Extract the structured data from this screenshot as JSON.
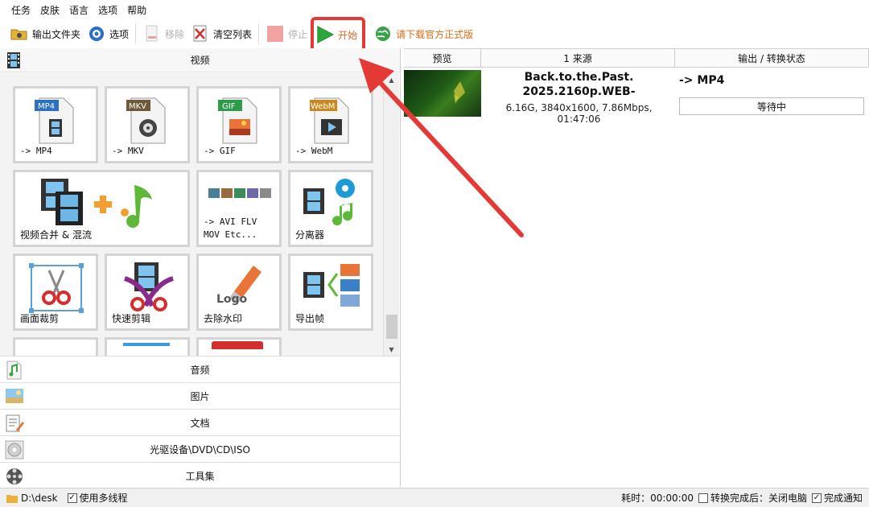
{
  "menu": [
    "任务",
    "皮肤",
    "语言",
    "选项",
    "帮助"
  ],
  "toolbar": {
    "output_folder": "输出文件夹",
    "options": "选项",
    "remove": "移除",
    "clear_list": "清空列表",
    "stop": "停止",
    "start": "开始",
    "download": "请下载官方正式版"
  },
  "left_panel": {
    "video_header": "视频",
    "tiles": [
      {
        "label": "-> MP4",
        "icon": "mp4-file-icon",
        "badge": "MP4",
        "badge_color": "#2f6fbf"
      },
      {
        "label": "-> MKV",
        "icon": "mkv-file-icon",
        "badge": "MKV",
        "badge_color": "#6d5a3a"
      },
      {
        "label": "-> GIF",
        "icon": "gif-file-icon",
        "badge": "GIF",
        "badge_color": "#2e9b4a"
      },
      {
        "label": "-> WebM",
        "icon": "webm-file-icon",
        "badge": "WebM",
        "badge_color": "#c8891e"
      },
      {
        "label": "视频合并 & 混流",
        "icon": "video-merge-icon"
      },
      {
        "label": "-> AVI FLV\nMOV Etc...",
        "icon": "other-formats-icon"
      },
      {
        "label": "分离器",
        "icon": "splitter-icon"
      },
      {
        "label": "画面裁剪",
        "icon": "crop-icon"
      },
      {
        "label": "快速剪辑",
        "icon": "quick-clip-icon"
      },
      {
        "label": "去除水印",
        "icon": "remove-watermark-icon",
        "logo_text": "Logo"
      },
      {
        "label": "导出帧",
        "icon": "export-frames-icon"
      }
    ],
    "categories": [
      {
        "label": "音频",
        "icon": "audio-icon"
      },
      {
        "label": "图片",
        "icon": "picture-icon"
      },
      {
        "label": "文档",
        "icon": "document-icon"
      },
      {
        "label": "光驱设备\\DVD\\CD\\ISO",
        "icon": "disc-icon"
      },
      {
        "label": "工具集",
        "icon": "toolset-icon"
      }
    ]
  },
  "task_list": {
    "columns": [
      "预览",
      "1 来源",
      "输出 / 转换状态"
    ],
    "rows": [
      {
        "name": "Back.to.the.Past.\n2025.2160p.WEB-",
        "info": "6.16G, 3840x1600, 7.86Mbps, 01:47:06",
        "output": "-> MP4",
        "status": "等待中"
      }
    ]
  },
  "status_bar": {
    "path": "D:\\desk",
    "multithread_label": "使用多线程",
    "multithread_checked": true,
    "elapsed": "耗时：00:00:00",
    "after_convert_label": "转换完成后：关闭电脑",
    "after_convert_checked": false,
    "notify_label": "完成通知",
    "notify_checked": true
  },
  "colors": {
    "highlight": "#e53935",
    "start_green": "#2aa83a",
    "promo_orange": "#e06a12"
  }
}
